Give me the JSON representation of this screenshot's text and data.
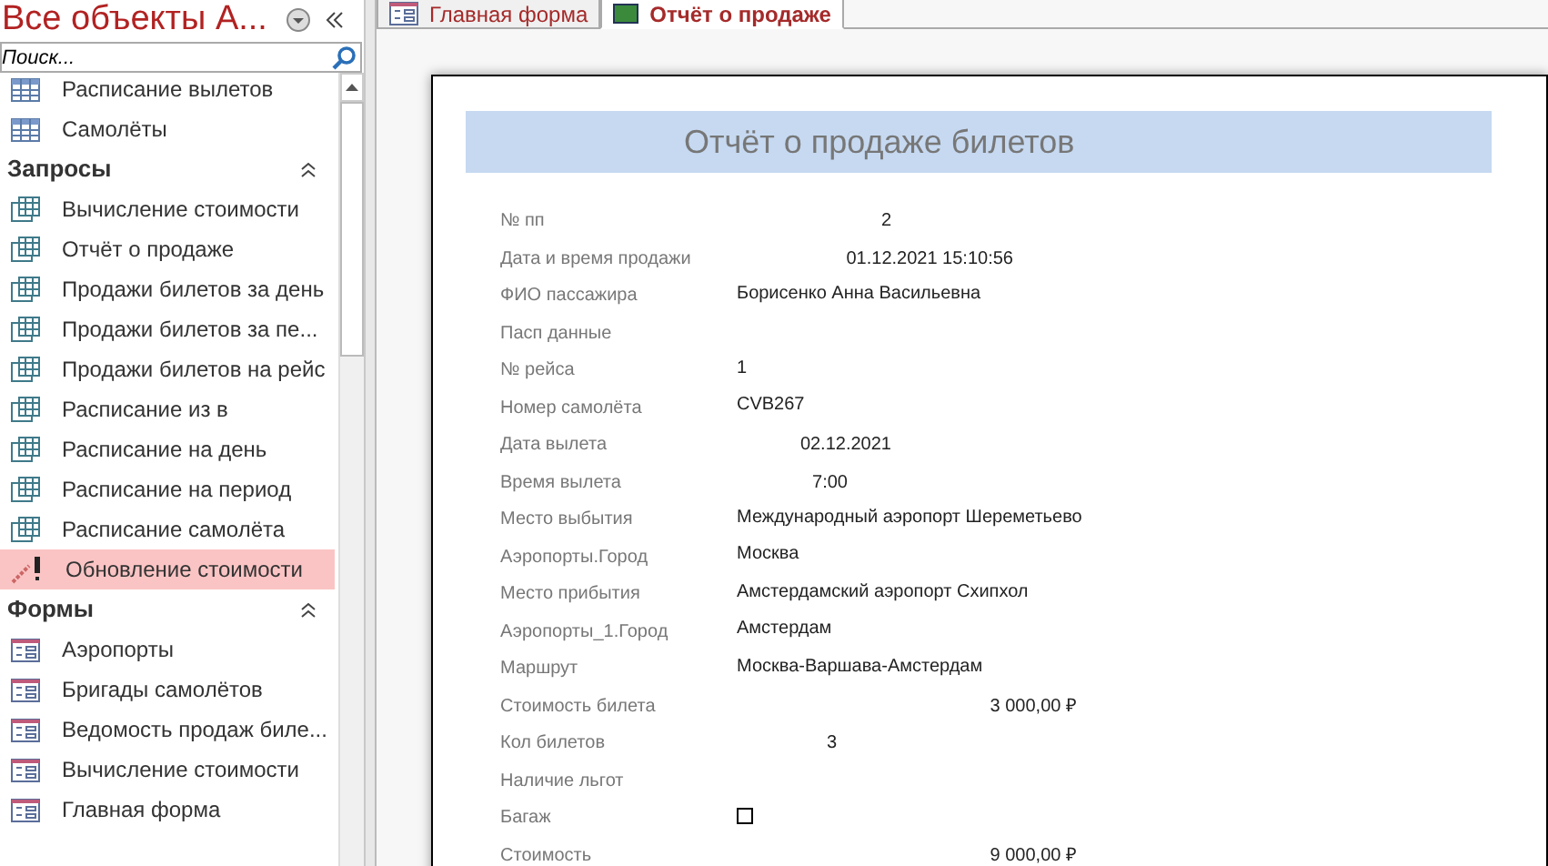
{
  "nav": {
    "title": "Все объекты A...",
    "search": {
      "placeholder": "Поиск..."
    },
    "groups": [
      {
        "items": [
          {
            "label": "Расписание вылетов",
            "kind": "table",
            "selected": false
          },
          {
            "label": "Самолёты",
            "kind": "table",
            "selected": false
          }
        ]
      },
      {
        "title": "Запросы",
        "items": [
          {
            "label": "Вычисление стоимости",
            "kind": "query",
            "selected": false
          },
          {
            "label": "Отчёт о продаже",
            "kind": "query",
            "selected": false
          },
          {
            "label": "Продажи билетов за день",
            "kind": "query",
            "selected": false
          },
          {
            "label": "Продажи билетов за пе...",
            "kind": "query",
            "selected": false
          },
          {
            "label": "Продажи билетов на рейс",
            "kind": "query",
            "selected": false
          },
          {
            "label": "Расписание из в",
            "kind": "query",
            "selected": false
          },
          {
            "label": "Расписание на день",
            "kind": "query",
            "selected": false
          },
          {
            "label": "Расписание на период",
            "kind": "query",
            "selected": false
          },
          {
            "label": "Расписание самолёта",
            "kind": "query",
            "selected": false
          },
          {
            "label": "Обновление стоимости",
            "kind": "update",
            "selected": true
          }
        ]
      },
      {
        "title": "Формы",
        "items": [
          {
            "label": "Аэропорты",
            "kind": "form",
            "selected": false
          },
          {
            "label": "Бригады самолётов",
            "kind": "form",
            "selected": false
          },
          {
            "label": "Ведомость продаж биле...",
            "kind": "form",
            "selected": false
          },
          {
            "label": "Вычисление стоимости",
            "kind": "form",
            "selected": false
          },
          {
            "label": "Главная форма",
            "kind": "form",
            "selected": false
          }
        ]
      }
    ]
  },
  "tabs": [
    {
      "label": "Главная форма",
      "kind": "form",
      "selected": false
    },
    {
      "label": "Отчёт о продаже",
      "kind": "report",
      "selected": true
    }
  ],
  "report": {
    "title": "Отчёт о продаже билетов",
    "fields": [
      {
        "label": "№ пп",
        "kind": "short",
        "value": "2"
      },
      {
        "label": "Дата и время продажи",
        "kind": "datetime",
        "value": "01.12.2021 15:10:56"
      },
      {
        "label": "ФИО пассажира",
        "kind": "text",
        "value": "Борисенко Анна Васильевна"
      },
      {
        "label": "Пасп данные",
        "kind": "text"
      },
      {
        "label": "№ рейса",
        "kind": "text",
        "value": "1"
      },
      {
        "label": "Номер самолёта",
        "kind": "text",
        "value": "CVB267"
      },
      {
        "label": "Дата вылета",
        "kind": "date",
        "value": "02.12.2021"
      },
      {
        "label": "Время вылета",
        "kind": "time",
        "value": "7:00"
      },
      {
        "label": "Место выбытия",
        "kind": "text",
        "value": "Международный аэропорт Шереметьево"
      },
      {
        "label": "Аэропорты.Город",
        "kind": "text",
        "value": "Москва"
      },
      {
        "label": "Место прибытия",
        "kind": "text",
        "value": "Амстердамский аэропорт Схипхол"
      },
      {
        "label": "Аэропорты_1.Город",
        "kind": "text",
        "value": "Амстердам"
      },
      {
        "label": "Маршрут",
        "kind": "text",
        "value": "Москва-Варшава-Амстердам"
      },
      {
        "label": "Стоимость билета",
        "kind": "money",
        "value": "3 000,00 ₽"
      },
      {
        "label": "Кол билетов",
        "kind": "count",
        "value": "3"
      },
      {
        "label": "Наличие льгот",
        "kind": "text"
      },
      {
        "label": "Багаж",
        "kind": "check",
        "checked": false
      },
      {
        "label": "Стоимость",
        "kind": "money",
        "value": "9 000,00 ₽"
      }
    ]
  }
}
